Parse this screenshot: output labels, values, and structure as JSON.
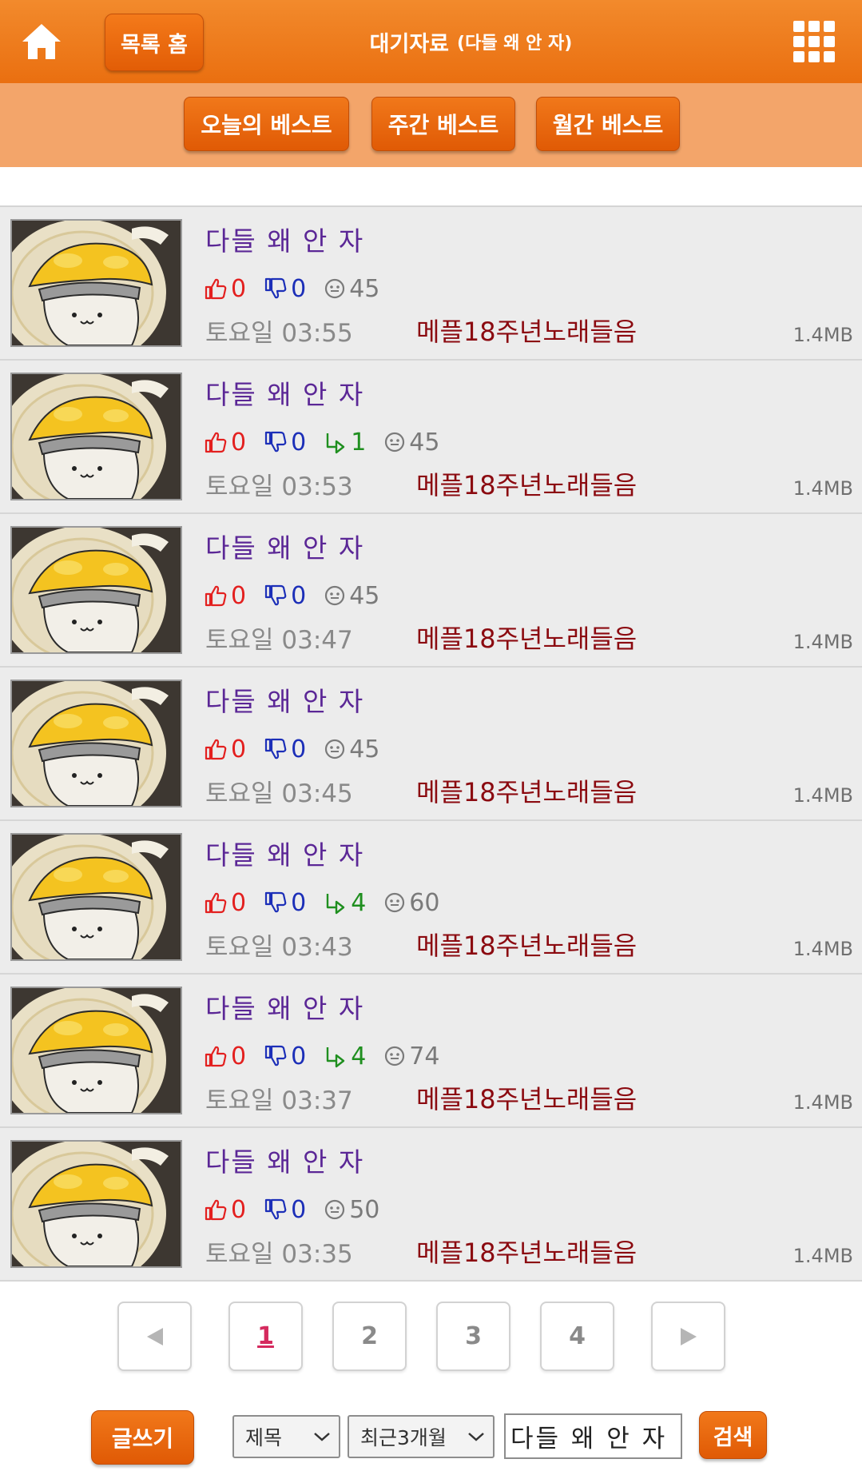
{
  "header": {
    "home_icon": "home-icon",
    "list_home_label": "목록 홈",
    "title_main": "대기자료",
    "title_sub": "(다들 왜 안 자)",
    "menu_icon": "grid-menu-icon"
  },
  "best_tabs": [
    {
      "label": "오늘의 베스트"
    },
    {
      "label": "주간 베스트"
    },
    {
      "label": "월간 베스트"
    }
  ],
  "posts": [
    {
      "title": "다들 왜 안 자",
      "likes": "0",
      "dislikes": "0",
      "replies": "",
      "views": "45",
      "date": "토요일 03:55",
      "tag": "메플18주년노래들음",
      "size": "1.4MB"
    },
    {
      "title": "다들 왜 안 자",
      "likes": "0",
      "dislikes": "0",
      "replies": "1",
      "views": "45",
      "date": "토요일 03:53",
      "tag": "메플18주년노래들음",
      "size": "1.4MB"
    },
    {
      "title": "다들 왜 안 자",
      "likes": "0",
      "dislikes": "0",
      "replies": "",
      "views": "45",
      "date": "토요일 03:47",
      "tag": "메플18주년노래들음",
      "size": "1.4MB"
    },
    {
      "title": "다들 왜 안 자",
      "likes": "0",
      "dislikes": "0",
      "replies": "",
      "views": "45",
      "date": "토요일 03:45",
      "tag": "메플18주년노래들음",
      "size": "1.4MB"
    },
    {
      "title": "다들 왜 안 자",
      "likes": "0",
      "dislikes": "0",
      "replies": "4",
      "views": "60",
      "date": "토요일 03:43",
      "tag": "메플18주년노래들음",
      "size": "1.4MB"
    },
    {
      "title": "다들 왜 안 자",
      "likes": "0",
      "dislikes": "0",
      "replies": "4",
      "views": "74",
      "date": "토요일 03:37",
      "tag": "메플18주년노래들음",
      "size": "1.4MB"
    },
    {
      "title": "다들 왜 안 자",
      "likes": "0",
      "dislikes": "0",
      "replies": "",
      "views": "50",
      "date": "토요일 03:35",
      "tag": "메플18주년노래들음",
      "size": "1.4MB"
    }
  ],
  "pagination": {
    "prev_icon": "triangle-left-icon",
    "next_icon": "triangle-right-icon",
    "pages": [
      "1",
      "2",
      "3",
      "4"
    ],
    "current": "1"
  },
  "search": {
    "write_label": "글쓰기",
    "field_select": "제목",
    "period_select": "최근3개월",
    "query": "다들 왜 안 자",
    "submit_label": "검색"
  },
  "colors": {
    "header": "#ea6f10",
    "best_bar": "#f3a56a",
    "title": "#5b2796",
    "like": "#e3201f",
    "dislike": "#1c2fb8",
    "reply": "#1f8f1f",
    "tag": "#8b0a10"
  }
}
